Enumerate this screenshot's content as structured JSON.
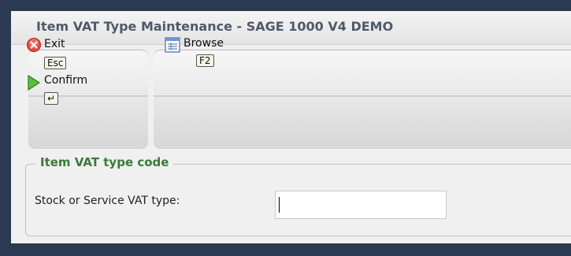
{
  "window": {
    "title": "Item VAT Type Maintenance - SAGE 1000 V4 DEMO"
  },
  "toolbar": {
    "exit": {
      "label": "Exit",
      "key": "Esc",
      "icon": "exit-icon"
    },
    "confirm": {
      "label": "Confirm",
      "key": "↵",
      "icon": "confirm-arrow-icon"
    },
    "browse": {
      "label": "Browse",
      "key": "F2",
      "icon": "browse-table-icon"
    }
  },
  "form": {
    "section_title": "Item VAT type code",
    "field_label": "Stock or Service VAT type:",
    "field_value": "",
    "field_placeholder": ""
  },
  "colors": {
    "frame": "#2a3a52",
    "legend_text": "#3a7a3a",
    "title_text": "#4e5a6a"
  }
}
